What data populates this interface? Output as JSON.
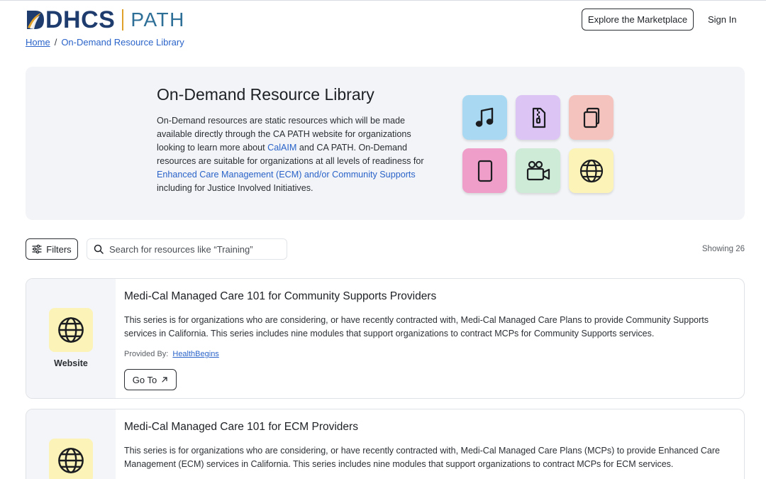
{
  "header": {
    "logo_main": "DHCS",
    "logo_sub": "PATH",
    "explore_label": "Explore the Marketplace",
    "signin_label": "Sign In"
  },
  "breadcrumb": {
    "home": "Home",
    "separator": "/",
    "current": "On-Demand Resource Library"
  },
  "hero": {
    "title": "On-Demand Resource Library",
    "text_1": "On-Demand resources are static resources which will be made available directly through the CA PATH website for organizations looking to learn more about ",
    "link_calaim": "CalAIM",
    "text_2": " and CA PATH. On-Demand resources are suitable for organizations at all levels of readiness for ",
    "link_ecm": "Enhanced Care Management (ECM) and/or Community Supports",
    "text_3": " including for Justice Involved Initiatives.",
    "tiles": [
      {
        "icon": "music-note-icon",
        "color": "#a9d9f2"
      },
      {
        "icon": "zip-file-icon",
        "color": "#dcc4f4"
      },
      {
        "icon": "copy-files-icon",
        "color": "#f5c3bd"
      },
      {
        "icon": "tablet-icon",
        "color": "#ef9ec9"
      },
      {
        "icon": "video-camera-icon",
        "color": "#cdebd6"
      },
      {
        "icon": "globe-icon",
        "color": "#fbf3b8"
      }
    ]
  },
  "toolbar": {
    "filters_label": "Filters",
    "search_placeholder": "Search for resources like “Training”",
    "showing": "Showing 26"
  },
  "resources": [
    {
      "type": "Website",
      "icon": "globe-icon",
      "title": "Medi-Cal Managed Care 101 for Community Supports Providers",
      "description": "This series is for organizations who are considering, or have recently contracted with, Medi-Cal Managed Care Plans to provide Community Supports services in California. This series includes nine modules that support organizations to contract MCPs for Community Supports services.",
      "provided_by_label": "Provided By:",
      "provider": "HealthBegins",
      "goto_label": "Go To"
    },
    {
      "type": "Website",
      "icon": "globe-icon",
      "title": "Medi-Cal Managed Care 101 for ECM Providers",
      "description": "This series is for organizations who are considering, or have recently contracted with, Medi-Cal Managed Care Plans (MCPs) to provide Enhanced Care Management (ECM) services in California. This series includes nine modules that support organizations to contract MCPs for ECM services."
    }
  ],
  "colors": {
    "link": "#2a63c9",
    "logo_navy": "#1f3c6e",
    "logo_teal": "#2e6f97",
    "logo_gold": "#e0a12b",
    "hero_bg": "#f2f4f7",
    "card_icon_bg": "#fbf3b8"
  }
}
